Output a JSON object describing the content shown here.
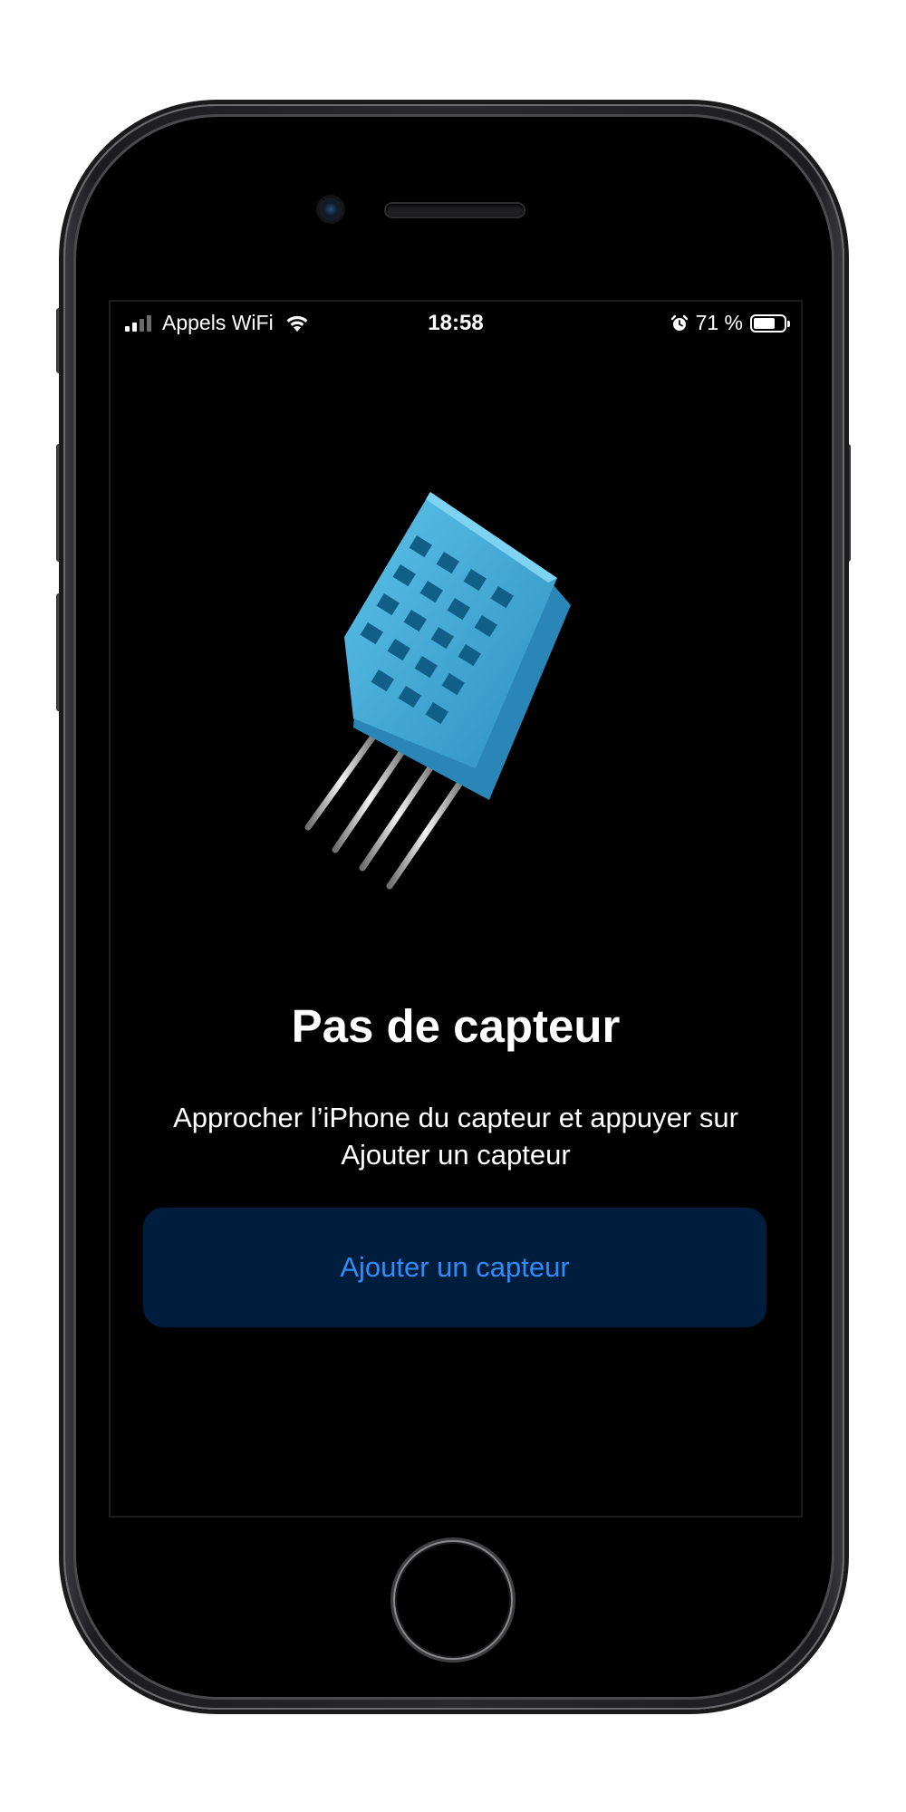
{
  "status_bar": {
    "carrier": "Appels WiFi",
    "time": "18:58",
    "battery_text": "71 %",
    "battery_level": 0.71,
    "icons": [
      "signal-icon",
      "wifi-icon",
      "alarm-icon",
      "battery-icon"
    ]
  },
  "main": {
    "illustration": "sensor-image",
    "illustration_color": "#3fa9d6",
    "title": "Pas de capteur",
    "instructions_line1": "Approcher l’iPhone du capteur et appuyer sur",
    "instructions_line2": "Ajouter un capteur",
    "add_button_label": "Ajouter un capteur"
  },
  "colors": {
    "accent": "#2f8cf8",
    "button_bg": "#001d3d",
    "screen_bg": "#000000",
    "text": "#ffffff"
  }
}
